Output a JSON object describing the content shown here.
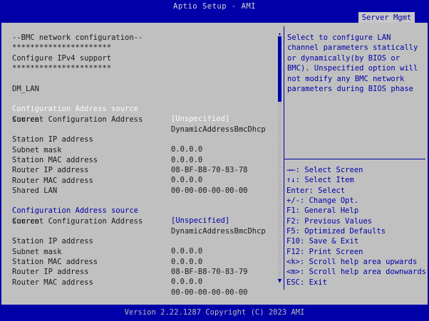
{
  "app": {
    "title": "Aptio Setup - AMI",
    "footer": "Version 2.22.1287 Copyright (C) 2023 AMI"
  },
  "tabs": [
    {
      "label": "Server Mgmt"
    }
  ],
  "left": {
    "heading": "--BMC network configuration--",
    "stars1": "**********************",
    "ipv4": "Configure IPv4 support",
    "stars2": "**********************",
    "dm_lan": {
      "title": "DM_LAN",
      "config_source_label": "Configuration Address source",
      "config_source_value": "[Unspecified]",
      "current_label_1": "Current Configuration Address",
      "current_label_2": "source",
      "current_value": "DynamicAddressBmcDhcp",
      "station_ip_label": "Station IP address",
      "station_ip_value": "0.0.0.0",
      "subnet_label": "Subnet mask",
      "subnet_value": "0.0.0.0",
      "station_mac_label": "Station MAC address",
      "station_mac_value": "08-BF-B8-70-83-78",
      "router_ip_label": "Router IP address",
      "router_ip_value": "0.0.0.0",
      "router_mac_label": "Router MAC address",
      "router_mac_value": "00-00-00-00-00-00"
    },
    "shared_lan": {
      "title": "Shared LAN",
      "config_source_label": "Configuration Address source",
      "config_source_value": "[Unspecified]",
      "current_label_1": "Current Configuration Address",
      "current_label_2": "source",
      "current_value": "DynamicAddressBmcDhcp",
      "station_ip_label": "Station IP address",
      "station_ip_value": "0.0.0.0",
      "subnet_label": "Subnet mask",
      "subnet_value": "0.0.0.0",
      "station_mac_label": "Station MAC address",
      "station_mac_value": "08-BF-B8-70-83-79",
      "router_ip_label": "Router IP address",
      "router_ip_value": "0.0.0.0",
      "router_mac_label": "Router MAC address",
      "router_mac_value": "00-00-00-00-00-00"
    }
  },
  "help": {
    "text": "Select to configure LAN\nchannel parameters statically\nor dynamically(by BIOS or\nBMC). Unspecified option will\nnot modify any BMC network\nparameters during BIOS phase"
  },
  "keys": [
    "→←: Select Screen",
    "↑↓: Select Item",
    "Enter: Select",
    "+/-: Change Opt.",
    "F1: General Help",
    "F2: Previous Values",
    "F5: Optimized Defaults",
    "F10: Save & Exit",
    "F12: Print Screen",
    "<k>: Scroll help area upwards",
    "<m>: Scroll help area downwards",
    "ESC: Exit"
  ],
  "scrollbar": {
    "up_icon": "triangle-up",
    "down_icon": "triangle-down"
  },
  "colors": {
    "background": "#0000a8",
    "panel": "#c0c0c0",
    "selected_text": "#fafafa",
    "accent": "#0000a8"
  }
}
